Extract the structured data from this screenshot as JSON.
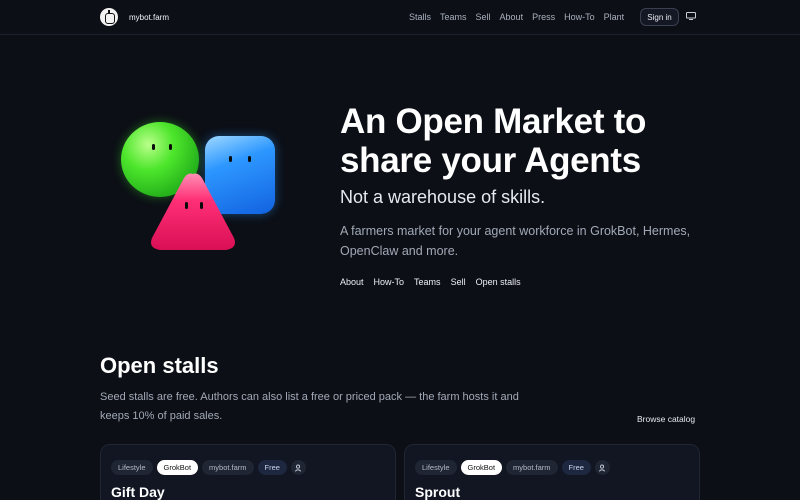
{
  "nav": {
    "brand": "mybot.farm",
    "links": [
      "Stalls",
      "Teams",
      "Sell",
      "About",
      "Press",
      "How-To",
      "Plant"
    ],
    "signin": "Sign in",
    "display_icon": "monitor-icon"
  },
  "hero": {
    "title": "An Open Market to share your Agents",
    "subtitle": "Not a warehouse of skills.",
    "description": "A farmers market for your agent workforce in GrokBot, Hermes, OpenClaw and more.",
    "links": [
      "About",
      "How-To",
      "Teams",
      "Sell",
      "Open stalls"
    ]
  },
  "stalls": {
    "title": "Open stalls",
    "description": "Seed stalls are free. Authors can also list a free or priced pack — the farm hosts it and keeps 10% of paid sales.",
    "browse": "Browse catalog",
    "cards": [
      {
        "tags": [
          "Lifestyle",
          "GrokBot",
          "mybot.farm",
          "Free"
        ],
        "title": "Gift Day"
      },
      {
        "tags": [
          "Lifestyle",
          "GrokBot",
          "mybot.farm",
          "Free"
        ],
        "title": "Sprout"
      }
    ]
  },
  "colors": {
    "background": "#0c0f16",
    "green_blob": "#3fd82a",
    "blue_blob": "#2d8cff",
    "red_blob": "#ff1f6a"
  }
}
